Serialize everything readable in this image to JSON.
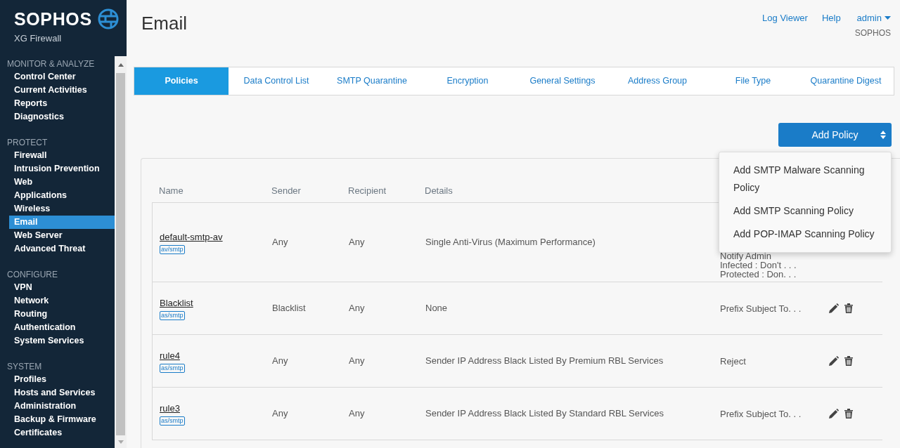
{
  "brand": {
    "name": "SOPHOS",
    "product": "XG Firewall"
  },
  "sidebar": {
    "sections": [
      {
        "title": "MONITOR & ANALYZE",
        "items": [
          {
            "label": "Control Center",
            "selected": false
          },
          {
            "label": "Current Activities",
            "selected": false
          },
          {
            "label": "Reports",
            "selected": false
          },
          {
            "label": "Diagnostics",
            "selected": false
          }
        ]
      },
      {
        "title": "PROTECT",
        "items": [
          {
            "label": "Firewall",
            "selected": false
          },
          {
            "label": "Intrusion Prevention",
            "selected": false
          },
          {
            "label": "Web",
            "selected": false
          },
          {
            "label": "Applications",
            "selected": false
          },
          {
            "label": "Wireless",
            "selected": false
          },
          {
            "label": "Email",
            "selected": true
          },
          {
            "label": "Web Server",
            "selected": false
          },
          {
            "label": "Advanced Threat",
            "selected": false
          }
        ]
      },
      {
        "title": "CONFIGURE",
        "items": [
          {
            "label": "VPN",
            "selected": false
          },
          {
            "label": "Network",
            "selected": false
          },
          {
            "label": "Routing",
            "selected": false
          },
          {
            "label": "Authentication",
            "selected": false
          },
          {
            "label": "System Services",
            "selected": false
          }
        ]
      },
      {
        "title": "SYSTEM",
        "items": [
          {
            "label": "Profiles",
            "selected": false
          },
          {
            "label": "Hosts and Services",
            "selected": false
          },
          {
            "label": "Administration",
            "selected": false
          },
          {
            "label": "Backup & Firmware",
            "selected": false
          },
          {
            "label": "Certificates",
            "selected": false
          }
        ]
      }
    ]
  },
  "page_title": "Email",
  "header_links": [
    "Log Viewer",
    "Help"
  ],
  "user": {
    "name": "admin",
    "org": "SOPHOS"
  },
  "tabs": [
    {
      "label": "Policies",
      "selected": true
    },
    {
      "label": "Data Control List",
      "selected": false
    },
    {
      "label": "SMTP Quarantine",
      "selected": false
    },
    {
      "label": "Encryption",
      "selected": false
    },
    {
      "label": "General Settings",
      "selected": false
    },
    {
      "label": "Address Group",
      "selected": false
    },
    {
      "label": "File Type",
      "selected": false
    },
    {
      "label": "Quarantine Digest",
      "selected": false
    }
  ],
  "add_button": "Add Policy",
  "add_menu": {
    "expanded": true,
    "items": [
      "Add SMTP Malware Scanning Policy",
      "Add SMTP Scanning Policy",
      "Add POP-IMAP Scanning Policy"
    ]
  },
  "table": {
    "columns": [
      "Name",
      "Sender",
      "Recipient",
      "Details"
    ],
    "rows": [
      {
        "name": "default-smtp-av",
        "tag": "av/smtp",
        "sender": "Any",
        "recipient": "Any",
        "details": "Single Anti-Virus (Maximum Performance)",
        "action": [
          "Notify Admin",
          "Infected : Don't . . .",
          "Protected : Don. . ."
        ]
      },
      {
        "name": "Blacklist",
        "tag": "as/smtp",
        "sender": "Blacklist",
        "recipient": "Any",
        "details": "None",
        "action": [
          "Prefix Subject To. . ."
        ]
      },
      {
        "name": "rule4",
        "tag": "as/smtp",
        "sender": "Any",
        "recipient": "Any",
        "details": "Sender IP Address Black Listed By Premium RBL Services",
        "action": [
          "Reject"
        ]
      },
      {
        "name": "rule3",
        "tag": "as/smtp",
        "sender": "Any",
        "recipient": "Any",
        "details": "Sender IP Address Black Listed By Standard RBL Services",
        "action": [
          "Prefix Subject To. . ."
        ]
      }
    ]
  }
}
